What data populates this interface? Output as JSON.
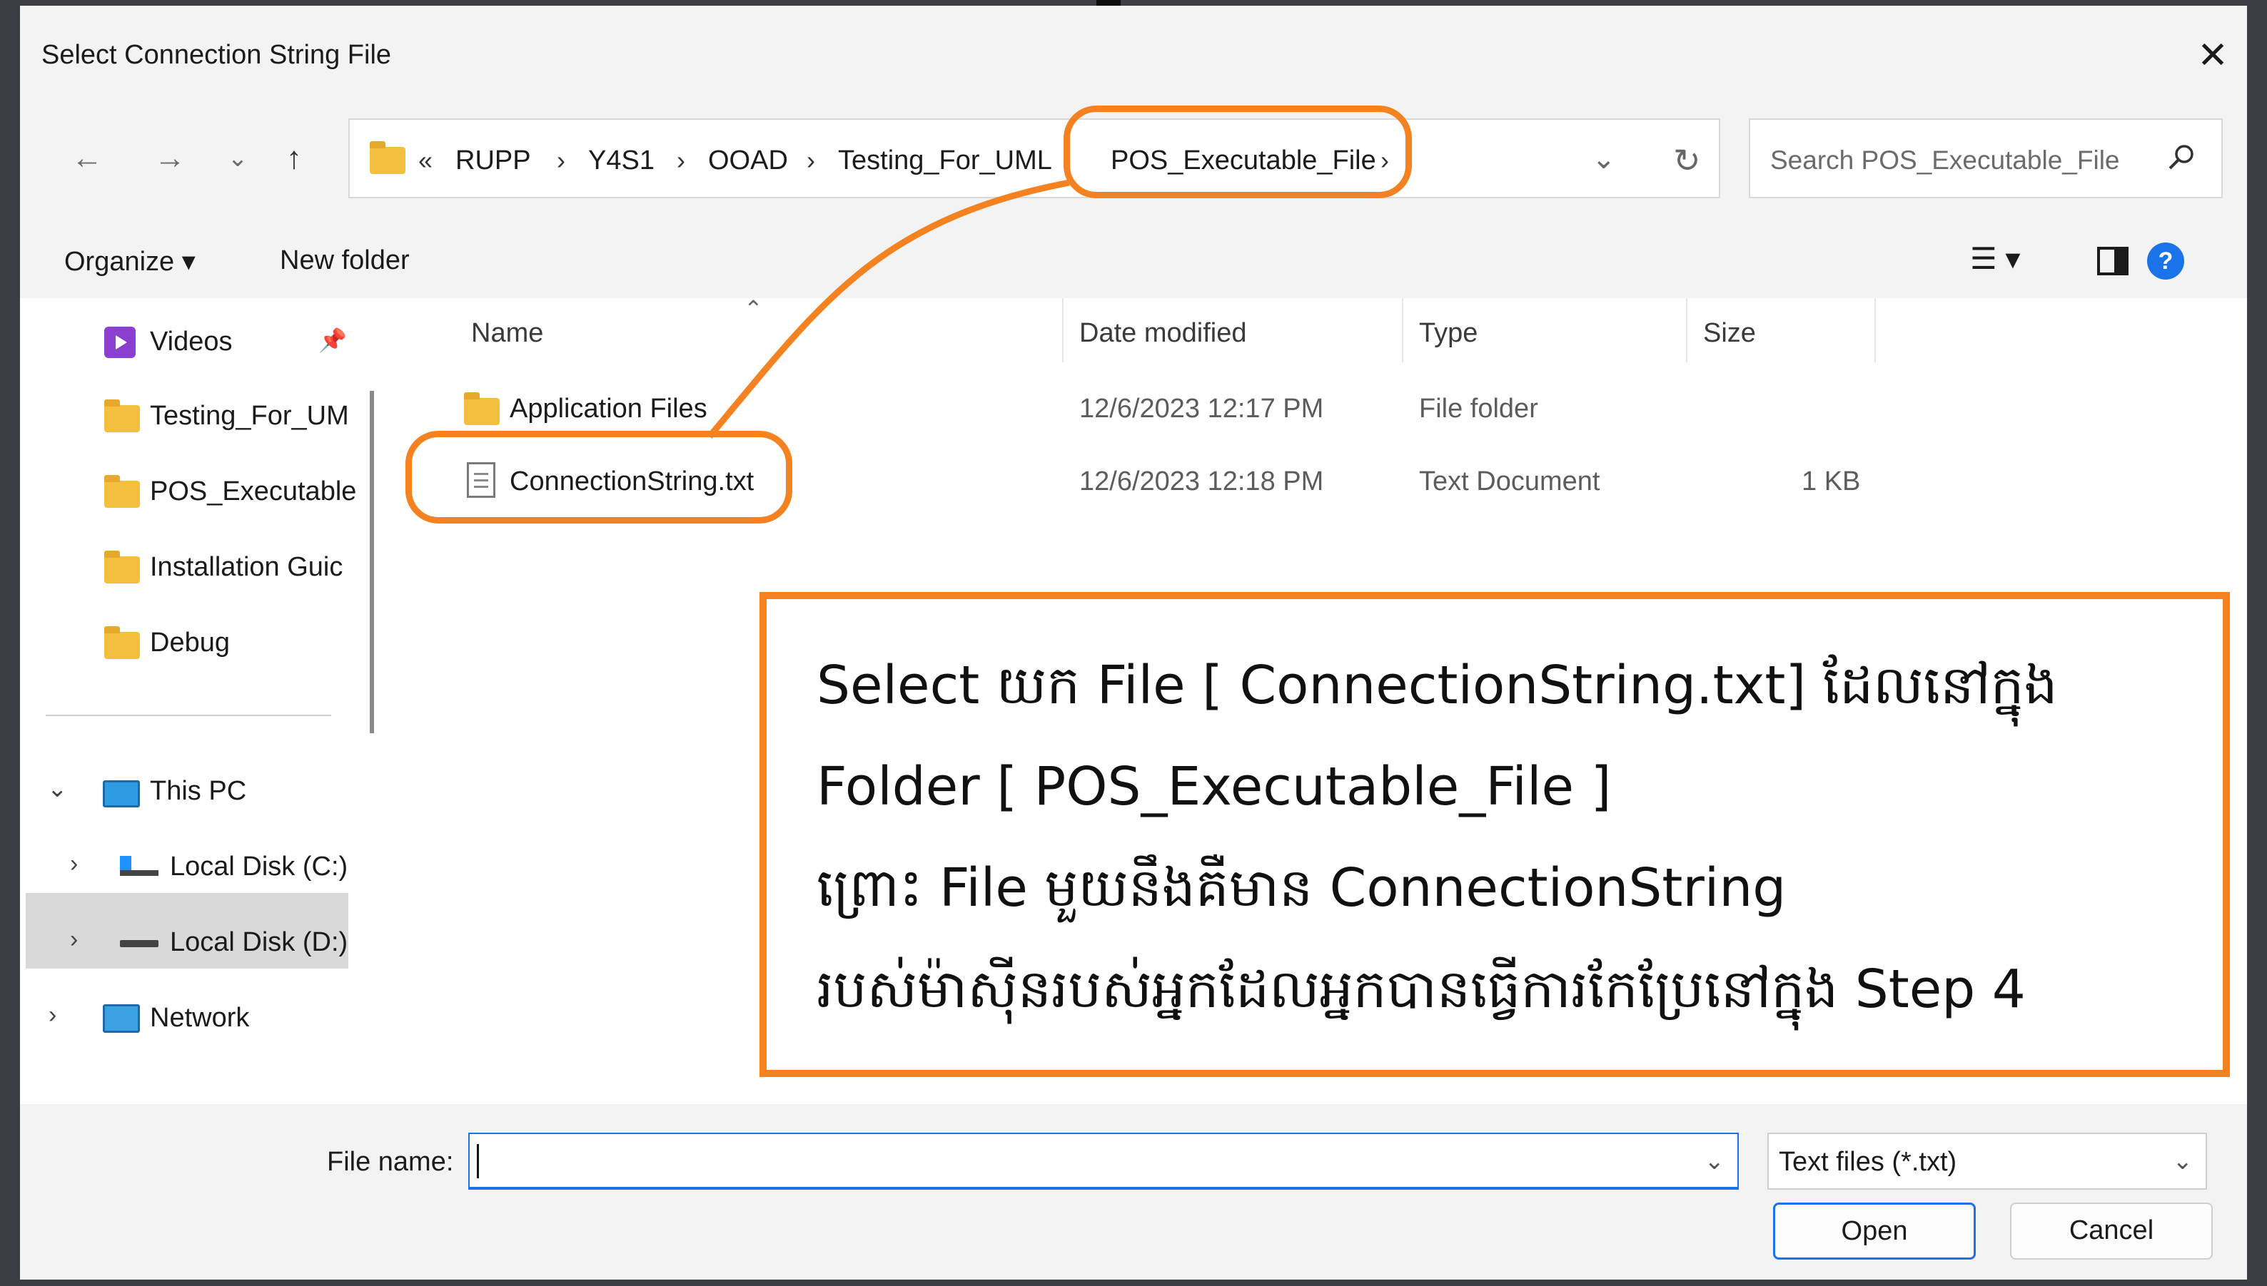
{
  "dialog": {
    "title": "Select Connection String File"
  },
  "nav": {
    "back_icon": "arrow-left-icon",
    "forward_icon": "arrow-right-icon",
    "recent_icon": "chevron-down-icon",
    "up_icon": "arrow-up-icon"
  },
  "address": {
    "overflow": "«",
    "crumbs": [
      "RUPP",
      "Y4S1",
      "OOAD",
      "Testing_For_UML",
      "POS_Executable_File"
    ]
  },
  "search": {
    "placeholder": "Search POS_Executable_File"
  },
  "toolbar": {
    "organize": "Organize ▾",
    "new_folder": "New folder"
  },
  "sidebar": {
    "items": [
      {
        "label": "Videos"
      },
      {
        "label": "Testing_For_UM"
      },
      {
        "label": "POS_Executable"
      },
      {
        "label": "Installation Guic"
      },
      {
        "label": "Debug"
      },
      {
        "label": "This PC"
      },
      {
        "label": "Local Disk (C:)"
      },
      {
        "label": "Local Disk (D:)"
      },
      {
        "label": "Network"
      }
    ]
  },
  "columns": {
    "name": "Name",
    "date": "Date modified",
    "type": "Type",
    "size": "Size"
  },
  "files": [
    {
      "name": "Application Files",
      "date": "12/6/2023 12:17 PM",
      "type": "File folder",
      "size": ""
    },
    {
      "name": "ConnectionString.txt",
      "date": "12/6/2023 12:18 PM",
      "type": "Text Document",
      "size": "1 KB"
    }
  ],
  "annotation": {
    "lines": [
      "Select យក File [ ConnectionString.txt] ដែលនៅក្នុង",
      "Folder [ POS_Executable_File ]",
      "ព្រោះ File មួយនឹងគឺមាន ConnectionString",
      "របស់ម៉ាស៊ីនរបស់អ្នកដែលអ្នកបានធ្វើការកែប្រែនៅក្នុង Step 4"
    ],
    "color": "#f58220"
  },
  "bottom": {
    "file_name_label": "File name:",
    "file_name_value": "",
    "file_type": "Text files (*.txt)",
    "open": "Open",
    "cancel": "Cancel"
  }
}
